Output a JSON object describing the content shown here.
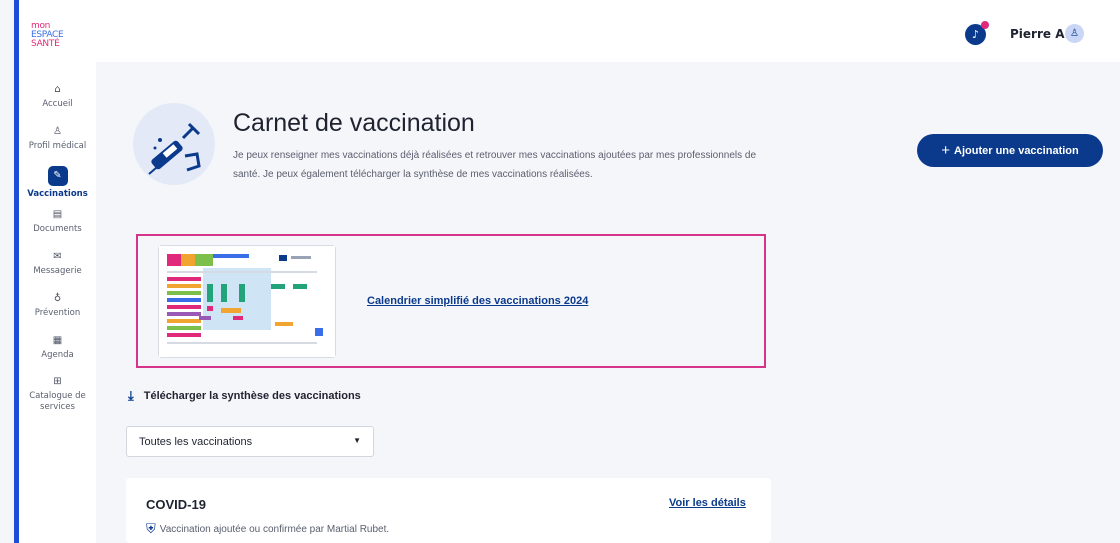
{
  "app": {
    "logo": {
      "line1": "mon",
      "line2": "ESPACE",
      "line3": "SANTÉ"
    },
    "accent_color": "#0b3a8c",
    "highlight_color": "#d6338a"
  },
  "header": {
    "user_name": "Pierre A.",
    "notification_icon": "bell-icon",
    "avatar_icon": "user-icon"
  },
  "sidebar": {
    "items": [
      {
        "label": "Accueil",
        "icon": "home-icon",
        "glyph": "⌂"
      },
      {
        "label": "Profil médical",
        "icon": "profile-icon",
        "glyph": "♙"
      },
      {
        "label": "Vaccinations",
        "icon": "syringe-icon",
        "glyph": "✎"
      },
      {
        "label": "Documents",
        "icon": "folder-icon",
        "glyph": "▤"
      },
      {
        "label": "Messagerie",
        "icon": "message-icon",
        "glyph": "✉"
      },
      {
        "label": "Prévention",
        "icon": "stethoscope-icon",
        "glyph": "♁"
      },
      {
        "label": "Agenda",
        "icon": "calendar-icon",
        "glyph": "▦"
      },
      {
        "label": "Catalogue de",
        "label2": "services",
        "icon": "grid-icon",
        "glyph": "⊞"
      }
    ]
  },
  "main": {
    "title": "Carnet de vaccination",
    "description": "Je peux renseigner mes vaccinations déjà réalisées et retrouver mes vaccinations ajoutées par mes professionnels de santé. Je peux également télécharger la synthèse de mes vaccinations réalisées.",
    "add_button": "Ajouter une vaccination",
    "calendar_link": "Calendrier simplifié des vaccinations 2024",
    "download_link": "Télécharger la synthèse des vaccinations",
    "filter": {
      "selected": "Toutes les vaccinations"
    },
    "cards": [
      {
        "title": "COVID-19",
        "link": "Voir les détails",
        "subtitle": "Vaccination ajoutée ou confirmée par Martial Rubet."
      }
    ]
  }
}
